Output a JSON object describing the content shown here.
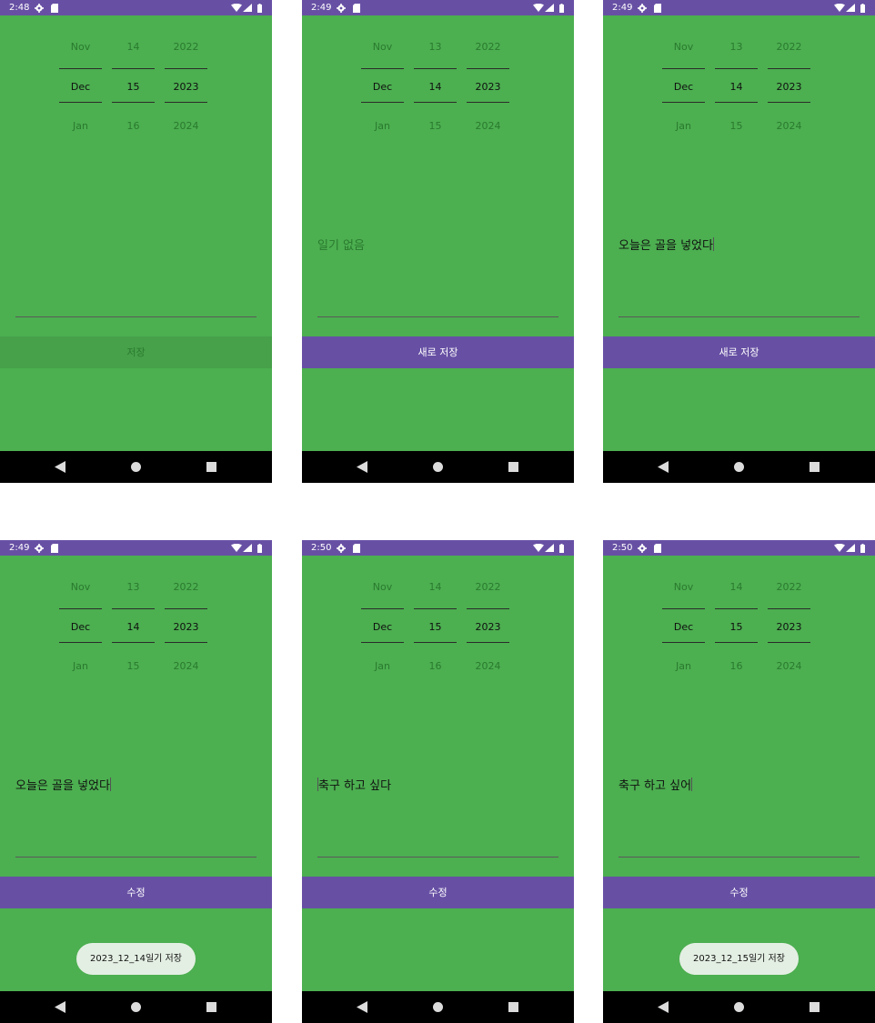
{
  "colors": {
    "background": "#4caf50",
    "status_bar": "#6750a4",
    "button": "#6750a4",
    "button_disabled": "#47a04a",
    "nav_bar": "#000000",
    "toast": "#e4efe3"
  },
  "screens": [
    {
      "status_time": "2:48",
      "picker": {
        "month": {
          "prev": "Nov",
          "cur": "Dec",
          "next": "Jan"
        },
        "day": {
          "prev": "14",
          "cur": "15",
          "next": "16"
        },
        "year": {
          "prev": "2022",
          "cur": "2023",
          "next": "2024"
        }
      },
      "memo": {
        "text": "",
        "is_hint": false,
        "cursor": "none"
      },
      "button": {
        "label": "저장",
        "enabled": false
      },
      "toast": ""
    },
    {
      "status_time": "2:49",
      "picker": {
        "month": {
          "prev": "Nov",
          "cur": "Dec",
          "next": "Jan"
        },
        "day": {
          "prev": "13",
          "cur": "14",
          "next": "15"
        },
        "year": {
          "prev": "2022",
          "cur": "2023",
          "next": "2024"
        }
      },
      "memo": {
        "text": "일기 없음",
        "is_hint": true,
        "cursor": "none"
      },
      "button": {
        "label": "새로 저장",
        "enabled": true
      },
      "toast": ""
    },
    {
      "status_time": "2:49",
      "picker": {
        "month": {
          "prev": "Nov",
          "cur": "Dec",
          "next": "Jan"
        },
        "day": {
          "prev": "13",
          "cur": "14",
          "next": "15"
        },
        "year": {
          "prev": "2022",
          "cur": "2023",
          "next": "2024"
        }
      },
      "memo": {
        "text": "오늘은 골을 넣었다",
        "is_hint": false,
        "cursor": "end"
      },
      "button": {
        "label": "새로 저장",
        "enabled": true
      },
      "toast": ""
    },
    {
      "status_time": "2:49",
      "picker": {
        "month": {
          "prev": "Nov",
          "cur": "Dec",
          "next": "Jan"
        },
        "day": {
          "prev": "13",
          "cur": "14",
          "next": "15"
        },
        "year": {
          "prev": "2022",
          "cur": "2023",
          "next": "2024"
        }
      },
      "memo": {
        "text": "오늘은 골을 넣었다",
        "is_hint": false,
        "cursor": "end"
      },
      "button": {
        "label": "수정",
        "enabled": true
      },
      "toast": "2023_12_14일기 저장"
    },
    {
      "status_time": "2:50",
      "picker": {
        "month": {
          "prev": "Nov",
          "cur": "Dec",
          "next": "Jan"
        },
        "day": {
          "prev": "14",
          "cur": "15",
          "next": "16"
        },
        "year": {
          "prev": "2022",
          "cur": "2023",
          "next": "2024"
        }
      },
      "memo": {
        "text": "축구 하고 싶다",
        "is_hint": false,
        "cursor": "start"
      },
      "button": {
        "label": "수정",
        "enabled": true
      },
      "toast": ""
    },
    {
      "status_time": "2:50",
      "picker": {
        "month": {
          "prev": "Nov",
          "cur": "Dec",
          "next": "Jan"
        },
        "day": {
          "prev": "14",
          "cur": "15",
          "next": "16"
        },
        "year": {
          "prev": "2022",
          "cur": "2023",
          "next": "2024"
        }
      },
      "memo": {
        "text": "축구 하고 싶어",
        "is_hint": false,
        "cursor": "end"
      },
      "button": {
        "label": "수정",
        "enabled": true
      },
      "toast": "2023_12_15일기 저장"
    }
  ]
}
